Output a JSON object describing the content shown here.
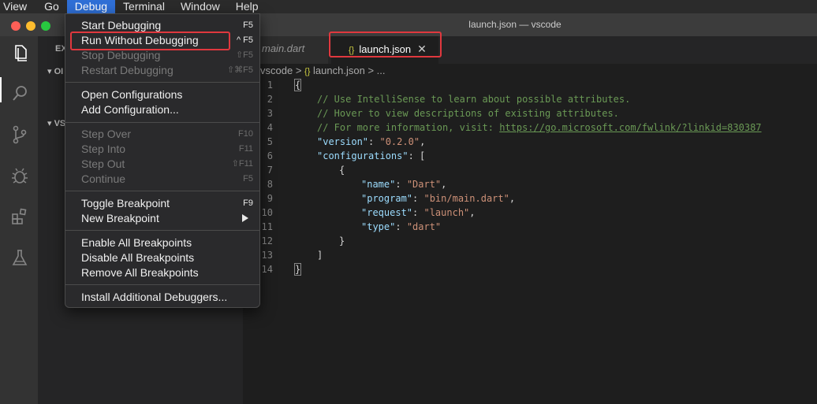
{
  "menubar": {
    "items": [
      "View",
      "Go",
      "Debug",
      "Terminal",
      "Window",
      "Help"
    ],
    "active": "Debug"
  },
  "window": {
    "title": "launch.json — vscode"
  },
  "tabs": [
    {
      "label": "main.dart",
      "active": false
    },
    {
      "label": "launch.json",
      "icon": "{}",
      "active": true
    }
  ],
  "breadcrumb": {
    "folder": "vscode",
    "sep": ">",
    "icon": "{}",
    "file": "launch.json",
    "tail": "> ..."
  },
  "sidebar": {
    "fragments": [
      "EX",
      "OI",
      "VS"
    ]
  },
  "debug_menu": {
    "groups": [
      [
        {
          "label": "Start Debugging",
          "shortcut": "F5",
          "enabled": true
        },
        {
          "label": "Run Without Debugging",
          "shortcut": "^ F5",
          "enabled": true,
          "highlighted": true
        },
        {
          "label": "Stop Debugging",
          "shortcut": "⇧F5",
          "enabled": false
        },
        {
          "label": "Restart Debugging",
          "shortcut": "⇧⌘F5",
          "enabled": false
        }
      ],
      [
        {
          "label": "Open Configurations",
          "shortcut": "",
          "enabled": true
        },
        {
          "label": "Add Configuration...",
          "shortcut": "",
          "enabled": true
        }
      ],
      [
        {
          "label": "Step Over",
          "shortcut": "F10",
          "enabled": false
        },
        {
          "label": "Step Into",
          "shortcut": "F11",
          "enabled": false
        },
        {
          "label": "Step Out",
          "shortcut": "⇧F11",
          "enabled": false
        },
        {
          "label": "Continue",
          "shortcut": "F5",
          "enabled": false
        }
      ],
      [
        {
          "label": "Toggle Breakpoint",
          "shortcut": "F9",
          "enabled": true
        },
        {
          "label": "New Breakpoint",
          "shortcut": "",
          "enabled": true,
          "submenu": true
        }
      ],
      [
        {
          "label": "Enable All Breakpoints",
          "shortcut": "",
          "enabled": true
        },
        {
          "label": "Disable All Breakpoints",
          "shortcut": "",
          "enabled": true
        },
        {
          "label": "Remove All Breakpoints",
          "shortcut": "",
          "enabled": true
        }
      ],
      [
        {
          "label": "Install Additional Debuggers...",
          "shortcut": "",
          "enabled": true
        }
      ]
    ]
  },
  "editor": {
    "line_numbers": [
      "1",
      "2",
      "3",
      "4",
      "5",
      "6",
      "7",
      "8",
      "9",
      "10",
      "11",
      "12",
      "13",
      "14"
    ],
    "lines": {
      "l1": "{",
      "l2": "// Use IntelliSense to learn about possible attributes.",
      "l3": "// Hover to view descriptions of existing attributes.",
      "l4_prefix": "// For more information, visit: ",
      "l4_link": "https://go.microsoft.com/fwlink/?linkid=830387",
      "l5_key": "\"version\"",
      "l5_val": "\"0.2.0\"",
      "l6_key": "\"configurations\"",
      "l6_rest": ": [",
      "l7": "{",
      "l8_key": "\"name\"",
      "l8_val": "\"Dart\"",
      "l9_key": "\"program\"",
      "l9_val": "\"bin/main.dart\"",
      "l10_key": "\"request\"",
      "l10_val": "\"launch\"",
      "l11_key": "\"type\"",
      "l11_val": "\"dart\"",
      "l12": "}",
      "l13": "]",
      "l14": "}"
    }
  },
  "colors": {
    "highlight_box": "#e0383e",
    "menu_active": "#2f6fd6"
  }
}
